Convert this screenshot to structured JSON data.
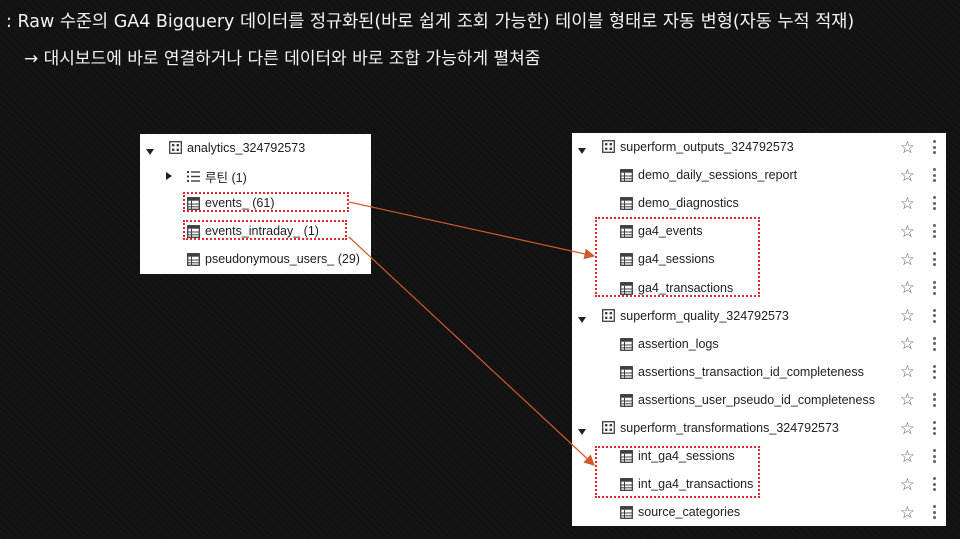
{
  "headline": ": Raw 수준의 GA4 Bigquery 데이터를 정규화된(바로 쉽게 조회 가능한) 테이블 형태로 자동 변형(자동 누적 적재)",
  "subline": "→ 대시보드에 바로 연결하거나 다른 데이터와 바로 조합 가능하게 펼쳐줌",
  "left_panel": {
    "dataset": "analytics_324792573",
    "routine": "루틴 (1)",
    "tables": [
      "events_ (61)",
      "events_intraday_ (1)",
      "pseudonymous_users_ (29)"
    ]
  },
  "right_panel": {
    "datasets": [
      {
        "name": "superform_outputs_324792573",
        "tables": [
          "demo_daily_sessions_report",
          "demo_diagnostics",
          "ga4_events",
          "ga4_sessions",
          "ga4_transactions"
        ]
      },
      {
        "name": "superform_quality_324792573",
        "tables": [
          "assertion_logs",
          "assertions_transaction_id_completeness",
          "assertions_user_pseudo_id_completeness"
        ]
      },
      {
        "name": "superform_transformations_324792573",
        "tables": [
          "int_ga4_sessions",
          "int_ga4_transactions",
          "source_categories"
        ]
      }
    ]
  },
  "colors": {
    "highlight": "#e2262c",
    "arrow": "#d05a2a",
    "panel_bg": "#ffffff"
  },
  "icons": {
    "dataset": "dataset-grid-icon",
    "table": "table-icon",
    "routine": "routine-list-icon",
    "star": "star-icon",
    "more": "more-vert-icon"
  }
}
